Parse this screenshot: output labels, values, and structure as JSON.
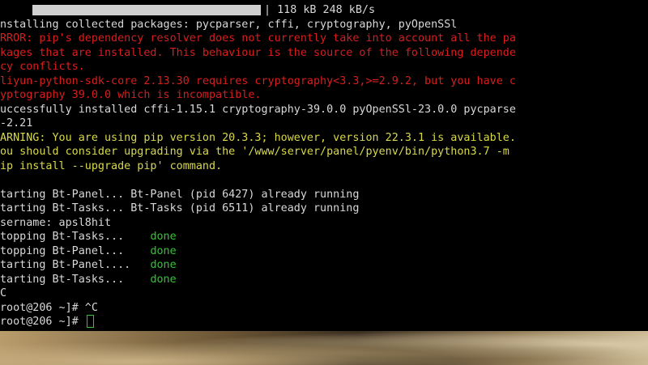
{
  "terminal": {
    "progress_text": "| 118 kB 248 kB/s",
    "lines": [
      "nstalling collected packages: pycparser, cffi, cryptography, pyOpenSSl",
      "RROR: pip's dependency resolver does not currently take into account all the pa",
      "kages that are installed. This behaviour is the source of the following depende",
      "cy conflicts.",
      "liyun-python-sdk-core 2.13.30 requires cryptography<3.3,>=2.9.2, but you have c",
      "yptography 39.0.0 which is incompatible.",
      "uccessfully installed cffi-1.15.1 cryptography-39.0.0 pyOpenSSl-23.0.0 pycparse",
      "-2.21",
      "ARNING: You are using pip version 20.3.3; however, version 22.3.1 is available.",
      "ou should consider upgrading via the '/www/server/panel/pyenv/bin/python3.7 -m",
      "ip install --upgrade pip' command.",
      "",
      "tarting Bt-Panel... Bt-Panel (pid 6427) already running",
      "tarting Bt-Tasks... Bt-Tasks (pid 6511) already running",
      "sername: apsl8hit",
      "topping Bt-Tasks...    ",
      "topping Bt-Panel...    ",
      "tarting Bt-Panel....   ",
      "tarting Bt-Tasks...    ",
      "C",
      "root@206 ~]# ^C",
      "root@206 ~]# "
    ],
    "done_label": "done"
  },
  "colors": {
    "background": "#000000",
    "text": "#d8d8d8",
    "error": "#d81e1e",
    "warning": "#d8d84a",
    "success": "#2ec82e"
  }
}
